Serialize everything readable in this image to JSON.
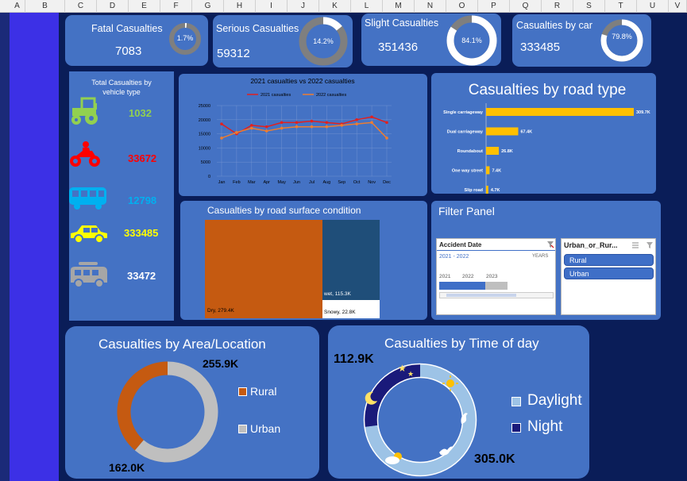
{
  "spreadsheet": {
    "columns": [
      "A",
      "B",
      "C",
      "D",
      "E",
      "F",
      "G",
      "H",
      "I",
      "J",
      "K",
      "L",
      "M",
      "N",
      "O",
      "P",
      "Q",
      "R",
      "S",
      "T",
      "U",
      "V"
    ]
  },
  "kpis": {
    "fatal": {
      "title": "Fatal Casualties",
      "value": "7083",
      "pct_label": "1.7%",
      "pct": 1.7
    },
    "serious": {
      "title": "Serious Casualties",
      "value": "59312",
      "pct_label": "14.2%",
      "pct": 14.2
    },
    "slight": {
      "title": "Slight Casualties",
      "value": "351436",
      "pct_label": "84.1%",
      "pct": 84.1
    },
    "car": {
      "title": "Casualties by car",
      "value": "333485",
      "pct_label": "79.8%",
      "pct": 79.8
    }
  },
  "vehicles": {
    "title_line1": "Total  Casualties by",
    "title_line2": "vehicle type",
    "items": [
      {
        "icon": "tractor-icon",
        "value": "1032",
        "color": "#92d050"
      },
      {
        "icon": "motorcycle-icon",
        "value": "33672",
        "color": "#ff0000"
      },
      {
        "icon": "bus-icon",
        "value": "12798",
        "color": "#00b0f0"
      },
      {
        "icon": "car-icon",
        "value": "333485",
        "color": "#ffff00"
      },
      {
        "icon": "van-icon",
        "value": "33472",
        "color": "#ffffff"
      }
    ]
  },
  "line_chart": {
    "title": "2021 casualties vs 2022 casualties",
    "legend_2021": "2021 casualties",
    "legend_2022": "2022 casualties",
    "color_2021": "#e02020",
    "color_2022": "#ed7d31"
  },
  "bar_chart": {
    "title": "Casualties by road type",
    "color": "#ffc000"
  },
  "surface": {
    "title": "Casualties by road surface condition",
    "dry_label": "Dry, 279.4K",
    "wet_label": "wet, 115.3K",
    "snowy_label": "Snowy, 22.8K",
    "dry_color": "#c55a11",
    "wet_color": "#1f4e79"
  },
  "filter": {
    "title": "Filter Panel",
    "date_slicer": {
      "header": "Accident  Date",
      "range": "2021 - 2022",
      "period": "YEARS",
      "years": [
        "2021",
        "2022",
        "2023"
      ]
    },
    "area_slicer": {
      "header": "Urban_or_Rur...",
      "options": [
        "Rural",
        "Urban"
      ]
    }
  },
  "area": {
    "title": "Casualties by Area/Location",
    "urban_label": "255.9K",
    "rural_label": "162.0K",
    "legend_rural": "Rural",
    "legend_urban": "Urban",
    "rural_color": "#c55a11",
    "urban_color": "#bfbfbf"
  },
  "time": {
    "title": "Casualties by Time of day",
    "night_label": "112.9K",
    "day_label": "305.0K",
    "legend_day": "Daylight",
    "legend_night": "Night"
  },
  "chart_data": [
    {
      "type": "line",
      "title": "2021 casualties vs 2022 casualties",
      "categories": [
        "Jan",
        "Feb",
        "Mar",
        "Apr",
        "May",
        "Jun",
        "Jul",
        "Aug",
        "Sep",
        "Oct",
        "Nov",
        "Dec"
      ],
      "series": [
        {
          "name": "2021 casualties",
          "values": [
            18500,
            15000,
            18000,
            17500,
            19000,
            19000,
            19500,
            19000,
            18500,
            20000,
            21000,
            19000
          ]
        },
        {
          "name": "2022 casualties",
          "values": [
            13500,
            15500,
            17000,
            16000,
            17000,
            17500,
            17500,
            17500,
            18000,
            18500,
            19000,
            13500
          ]
        }
      ],
      "yticks": [
        "0",
        "5000",
        "10000",
        "15000",
        "20000",
        "25000"
      ],
      "ylim": [
        0,
        25000
      ]
    },
    {
      "type": "bar",
      "title": "Casualties by road type",
      "categories": [
        "Single carriageway",
        "Dual carriageway",
        "Roundabout",
        "One way street",
        "Slip road"
      ],
      "values": [
        309.7,
        67.4,
        26.8,
        7.4,
        4.7
      ],
      "value_labels": [
        "309.7K",
        "67.4K",
        "26.8K",
        "7.4K",
        "4.7K"
      ]
    },
    {
      "type": "pie",
      "title": "Casualties by Area/Location",
      "categories": [
        "Rural",
        "Urban"
      ],
      "values": [
        162.0,
        255.9
      ]
    },
    {
      "type": "pie",
      "title": "Casualties by Time of day",
      "categories": [
        "Daylight",
        "Night"
      ],
      "values": [
        305.0,
        112.9
      ]
    }
  ]
}
